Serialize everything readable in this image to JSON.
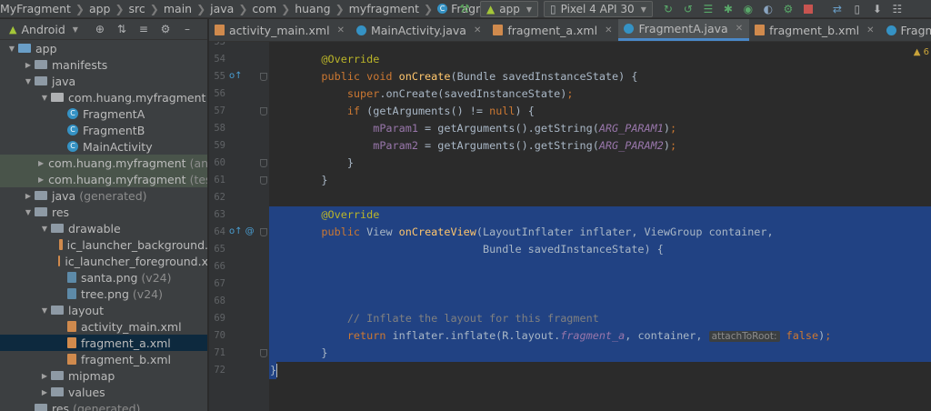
{
  "breadcrumb": [
    {
      "label": "MyFragment"
    },
    {
      "label": "app"
    },
    {
      "label": "src"
    },
    {
      "label": "main"
    },
    {
      "label": "java"
    },
    {
      "label": "com"
    },
    {
      "label": "huang"
    },
    {
      "label": "myfragment"
    },
    {
      "label": "FragmentA",
      "icon": "C"
    }
  ],
  "toolbar": {
    "config": "app",
    "device": "Pixel 4 API 30"
  },
  "panel": {
    "view_label": "Android"
  },
  "tree": [
    {
      "depth": 0,
      "arrow": "▼",
      "icon": "folder-blue",
      "label": "app",
      "gray": ""
    },
    {
      "depth": 1,
      "arrow": "▶",
      "icon": "folder",
      "label": "manifests",
      "gray": ""
    },
    {
      "depth": 1,
      "arrow": "▼",
      "icon": "folder",
      "label": "java",
      "gray": ""
    },
    {
      "depth": 2,
      "arrow": "▼",
      "icon": "package",
      "label": "com.huang.myfragment",
      "gray": ""
    },
    {
      "depth": 3,
      "arrow": "",
      "icon": "class",
      "label": "FragmentA",
      "gray": ""
    },
    {
      "depth": 3,
      "arrow": "",
      "icon": "class",
      "label": "FragmentB",
      "gray": ""
    },
    {
      "depth": 3,
      "arrow": "",
      "icon": "class",
      "label": "MainActivity",
      "gray": ""
    },
    {
      "depth": 2,
      "arrow": "▶",
      "icon": "package",
      "label": "com.huang.myfragment",
      "gray": "(an",
      "bg": "green"
    },
    {
      "depth": 2,
      "arrow": "▶",
      "icon": "package",
      "label": "com.huang.myfragment",
      "gray": "(tes",
      "bg": "green"
    },
    {
      "depth": 1,
      "arrow": "▶",
      "icon": "folder",
      "label": "java",
      "gray": "(generated)"
    },
    {
      "depth": 1,
      "arrow": "▼",
      "icon": "folder",
      "label": "res",
      "gray": ""
    },
    {
      "depth": 2,
      "arrow": "▼",
      "icon": "folder",
      "label": "drawable",
      "gray": ""
    },
    {
      "depth": 3,
      "arrow": "",
      "icon": "xml",
      "label": "ic_launcher_background.",
      "gray": ""
    },
    {
      "depth": 3,
      "arrow": "",
      "icon": "xml",
      "label": "ic_launcher_foreground.x",
      "gray": ""
    },
    {
      "depth": 3,
      "arrow": "",
      "icon": "png",
      "label": "santa.png",
      "gray": "(v24)"
    },
    {
      "depth": 3,
      "arrow": "",
      "icon": "png",
      "label": "tree.png",
      "gray": "(v24)"
    },
    {
      "depth": 2,
      "arrow": "▼",
      "icon": "folder",
      "label": "layout",
      "gray": ""
    },
    {
      "depth": 3,
      "arrow": "",
      "icon": "xml",
      "label": "activity_main.xml",
      "gray": ""
    },
    {
      "depth": 3,
      "arrow": "",
      "icon": "xml",
      "label": "fragment_a.xml",
      "gray": "",
      "bg": "sel"
    },
    {
      "depth": 3,
      "arrow": "",
      "icon": "xml",
      "label": "fragment_b.xml",
      "gray": ""
    },
    {
      "depth": 2,
      "arrow": "▶",
      "icon": "folder",
      "label": "mipmap",
      "gray": ""
    },
    {
      "depth": 2,
      "arrow": "▶",
      "icon": "folder",
      "label": "values",
      "gray": ""
    },
    {
      "depth": 1,
      "arrow": "",
      "icon": "folder",
      "label": "res",
      "gray": "(generated)"
    }
  ],
  "tabs": [
    {
      "label": "activity_main.xml",
      "icon": "xml"
    },
    {
      "label": "MainActivity.java",
      "icon": "class"
    },
    {
      "label": "fragment_a.xml",
      "icon": "xml"
    },
    {
      "label": "FragmentA.java",
      "icon": "class",
      "active": true
    },
    {
      "label": "fragment_b.xml",
      "icon": "xml"
    },
    {
      "label": "FragmentB.java",
      "icon": "class"
    }
  ],
  "editor": {
    "warning_count": "6",
    "lines": [
      {
        "num": "53",
        "tokens": []
      },
      {
        "num": "54",
        "tokens": [
          [
            "a",
            "    @Override"
          ]
        ]
      },
      {
        "num": "55",
        "gutter": "o↑",
        "fold": true,
        "tokens": [
          [
            "k",
            "    public void "
          ],
          [
            "f",
            "onCreate"
          ],
          [
            "p",
            "(Bundle savedInstanceState) {"
          ]
        ]
      },
      {
        "num": "56",
        "tokens": [
          [
            "k",
            "        super"
          ],
          [
            "p",
            ".onCreate(savedInstanceState)"
          ],
          [
            "k",
            ";"
          ]
        ]
      },
      {
        "num": "57",
        "fold": true,
        "tokens": [
          [
            "k",
            "        if "
          ],
          [
            "p",
            "(getArguments() != "
          ],
          [
            "k",
            "null"
          ],
          [
            "p",
            ") {"
          ]
        ]
      },
      {
        "num": "58",
        "tokens": [
          [
            "fd",
            "            mParam1 "
          ],
          [
            "p",
            "= getArguments().getString("
          ],
          [
            "it",
            "ARG_PARAM1"
          ],
          [
            "p",
            ")"
          ],
          [
            "k",
            ";"
          ]
        ]
      },
      {
        "num": "59",
        "tokens": [
          [
            "fd",
            "            mParam2 "
          ],
          [
            "p",
            "= getArguments().getString("
          ],
          [
            "it",
            "ARG_PARAM2"
          ],
          [
            "p",
            ")"
          ],
          [
            "k",
            ";"
          ]
        ]
      },
      {
        "num": "60",
        "fold": true,
        "tokens": [
          [
            "p",
            "        }"
          ]
        ]
      },
      {
        "num": "61",
        "fold": true,
        "tokens": [
          [
            "p",
            "    }"
          ]
        ]
      },
      {
        "num": "62",
        "tokens": []
      },
      {
        "num": "63",
        "sel": true,
        "tokens": [
          [
            "a",
            "    @Override"
          ]
        ]
      },
      {
        "num": "64",
        "sel": true,
        "gutter": "o↑ @",
        "fold": true,
        "tokens": [
          [
            "k",
            "    public "
          ],
          [
            "p",
            "View "
          ],
          [
            "f",
            "onCreateView"
          ],
          [
            "p",
            "(LayoutInflater inflater, ViewGroup container,"
          ]
        ]
      },
      {
        "num": "65",
        "sel": true,
        "tokens": [
          [
            "p",
            "                             Bundle savedInstanceState) {"
          ]
        ]
      },
      {
        "num": "66",
        "sel": true,
        "tokens": []
      },
      {
        "num": "67",
        "sel": true,
        "tokens": []
      },
      {
        "num": "68",
        "sel": true,
        "tokens": []
      },
      {
        "num": "69",
        "sel": true,
        "tokens": [
          [
            "cm",
            "        // Inflate the layout for this fragment"
          ]
        ]
      },
      {
        "num": "70",
        "sel": true,
        "tokens": [
          [
            "k",
            "        return "
          ],
          [
            "p",
            "inflater.inflate(R.layout."
          ],
          [
            "it",
            "fragment_a"
          ],
          [
            "p",
            ", container, "
          ],
          [
            "hint",
            "attachToRoot:"
          ],
          [
            "p",
            " "
          ],
          [
            "k",
            "false"
          ],
          [
            "p",
            ")"
          ],
          [
            "k",
            ";"
          ]
        ]
      },
      {
        "num": "71",
        "sel": true,
        "fold": true,
        "tokens": [
          [
            "p",
            "    }"
          ]
        ]
      },
      {
        "num": "72",
        "sel_partial": true,
        "caret": true,
        "tokens": [
          [
            "p",
            "}"
          ]
        ]
      }
    ]
  }
}
